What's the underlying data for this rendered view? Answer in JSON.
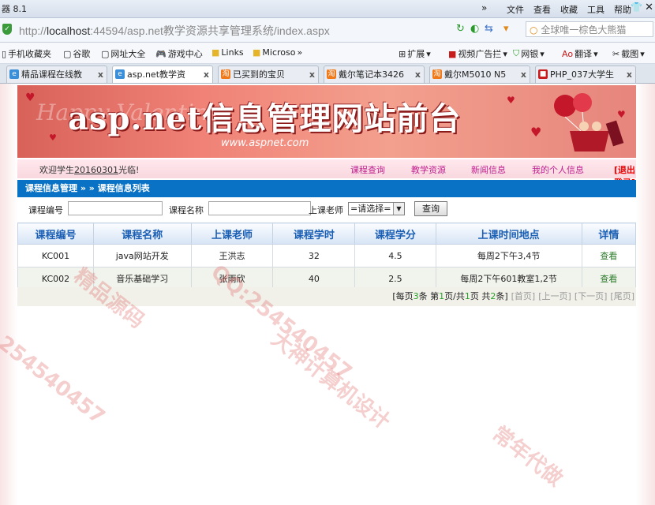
{
  "browser": {
    "app_title": "器 8.1",
    "menu": [
      "文件",
      "查看",
      "收藏",
      "工具",
      "帮助"
    ],
    "url_prefix": "http://",
    "url_host": "localhost",
    "url_rest": ":44594/asp.net教学资源共享管理系统/index.aspx",
    "search_placeholder": "全球唯一棕色大熊猫",
    "favorites": [
      {
        "icon": "phone-icon",
        "label": "手机收藏夹"
      },
      {
        "icon": "page-icon",
        "label": "谷歌"
      },
      {
        "icon": "page-icon",
        "label": "网址大全"
      },
      {
        "icon": "gamepad-icon",
        "label": "游戏中心"
      },
      {
        "icon": "folder-icon",
        "label": "Links"
      },
      {
        "icon": "folder-icon",
        "label": "Microso"
      }
    ],
    "tools": [
      "扩展",
      "视频广告拦",
      "网银",
      "翻译",
      "截图"
    ],
    "tabs": [
      {
        "label": "精品课程在线教",
        "active": false,
        "color": "#3a8fd8"
      },
      {
        "label": "asp.net教学资",
        "active": true,
        "color": "#3a8fd8"
      },
      {
        "label": "已买到的宝贝",
        "active": false,
        "color": "#f07a1a"
      },
      {
        "label": "戴尔笔记本3426",
        "active": false,
        "color": "#f07a1a"
      },
      {
        "label": "戴尔M5010 N5",
        "active": false,
        "color": "#f07a1a"
      },
      {
        "label": "PHP_037大学生",
        "active": false,
        "color": "#c81c1c"
      }
    ]
  },
  "site": {
    "banner_title": "asp.net信息管理网站前台",
    "banner_sub": "www.aspnet.com",
    "banner_script": "Happy Valentine",
    "welcome_prefix": "欢迎学生",
    "welcome_user": "20160301",
    "welcome_suffix": "光临!",
    "nav": [
      "课程查询",
      "教学资源",
      "新闻信息",
      "我的个人信息"
    ],
    "logout": "[退出登录]",
    "breadcrumb": "课程信息管理 » » 课程信息列表"
  },
  "filter": {
    "course_no_label": "课程编号",
    "course_name_label": "课程名称",
    "teacher_label": "上课老师",
    "teacher_select": "=请选择=",
    "query_button": "查询"
  },
  "table": {
    "headers": [
      "课程编号",
      "课程名称",
      "上课老师",
      "课程学时",
      "课程学分",
      "上课时间地点",
      "详情"
    ],
    "rows": [
      [
        "KC001",
        "java网站开发",
        "王洪志",
        "32",
        "4.5",
        "每周2下午3,4节",
        "查看"
      ],
      [
        "KC002",
        "音乐基础学习",
        "张雨欣",
        "40",
        "2.5",
        "每周2下午601教室1,2节",
        "查看"
      ]
    ]
  },
  "pager": {
    "per_page_prefix": "[每页",
    "per_page": "3",
    "per_page_suffix": "条 第",
    "page": "1",
    "page_mid": "页/共",
    "total_pages": "1",
    "total_prefix": "页 共",
    "total_rows": "2",
    "total_suffix": "条]",
    "first": "[首页]",
    "prev": "[上一页]",
    "next": "[下一页]",
    "last": "[尾页]"
  },
  "watermarks": [
    "QQ:254540457",
    "大神计算机设计",
    "精品源码",
    "254540457",
    "常年代做"
  ]
}
